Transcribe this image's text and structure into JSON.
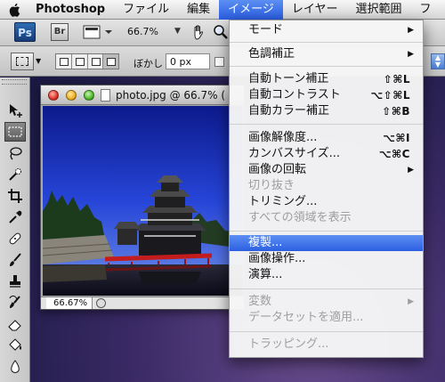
{
  "menubar": {
    "app_name": "Photoshop",
    "items": [
      "ファイル",
      "編集",
      "イメージ",
      "レイヤー",
      "選択範囲",
      "フ"
    ]
  },
  "appbar": {
    "ps_badge": "Ps",
    "br_badge": "Br",
    "zoom": "66.7%"
  },
  "optionsbar": {
    "feather_label": "ぼかし :",
    "feather_value": "0 px"
  },
  "document": {
    "title": "photo.jpg @ 66.7% (",
    "status_zoom": "66.67%"
  },
  "image_menu": {
    "items": [
      {
        "label": "モード",
        "submenu": true
      },
      {
        "label": "色調補正",
        "submenu": true
      },
      {
        "label": "自動トーン補正",
        "shortcut": "⇧⌘L"
      },
      {
        "label": "自動コントラスト",
        "shortcut": "⌥⇧⌘L"
      },
      {
        "label": "自動カラー補正",
        "shortcut": "⇧⌘B"
      },
      {
        "label": "画像解像度...",
        "shortcut": "⌥⌘I"
      },
      {
        "label": "カンバスサイズ...",
        "shortcut": "⌥⌘C"
      },
      {
        "label": "画像の回転",
        "submenu": true
      },
      {
        "label": "切り抜き",
        "disabled": true
      },
      {
        "label": "トリミング..."
      },
      {
        "label": "すべての領域を表示",
        "disabled": true
      },
      {
        "label": "複製...",
        "highlighted": true
      },
      {
        "label": "画像操作..."
      },
      {
        "label": "演算..."
      },
      {
        "label": "変数",
        "submenu": true,
        "disabled": true
      },
      {
        "label": "データセットを適用...",
        "disabled": true
      },
      {
        "label": "トラッピング...",
        "disabled": true
      }
    ]
  },
  "colors": {
    "menu_highlight": "#2b5fe0",
    "disabled_text": "#9e9e9e",
    "desktop": "#3a2a66"
  }
}
